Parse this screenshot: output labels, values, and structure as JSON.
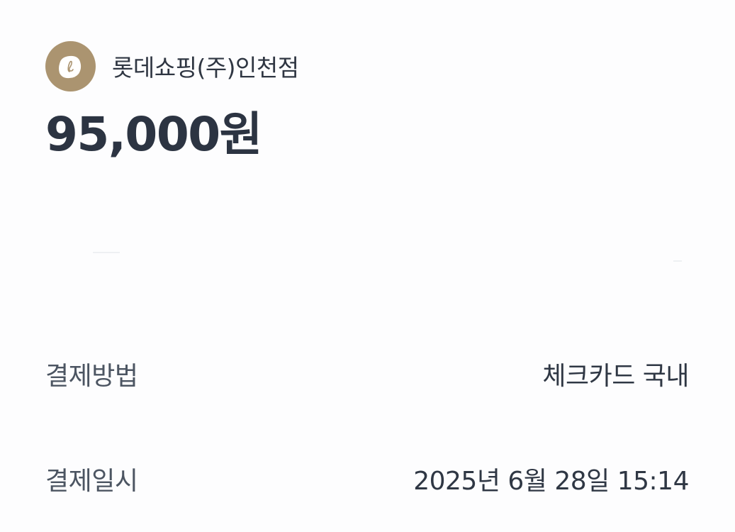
{
  "merchant": {
    "logo_icon": "lotte-shopping-logo-icon",
    "logo_color": "#ab9470",
    "name": "롯데쇼핑(주)인천점"
  },
  "amount": {
    "value": "95,000원"
  },
  "details": [
    {
      "label": "결제방법",
      "value": "체크카드 국내"
    },
    {
      "label": "결제일시",
      "value": "2025년 6월 28일 15:14"
    }
  ]
}
